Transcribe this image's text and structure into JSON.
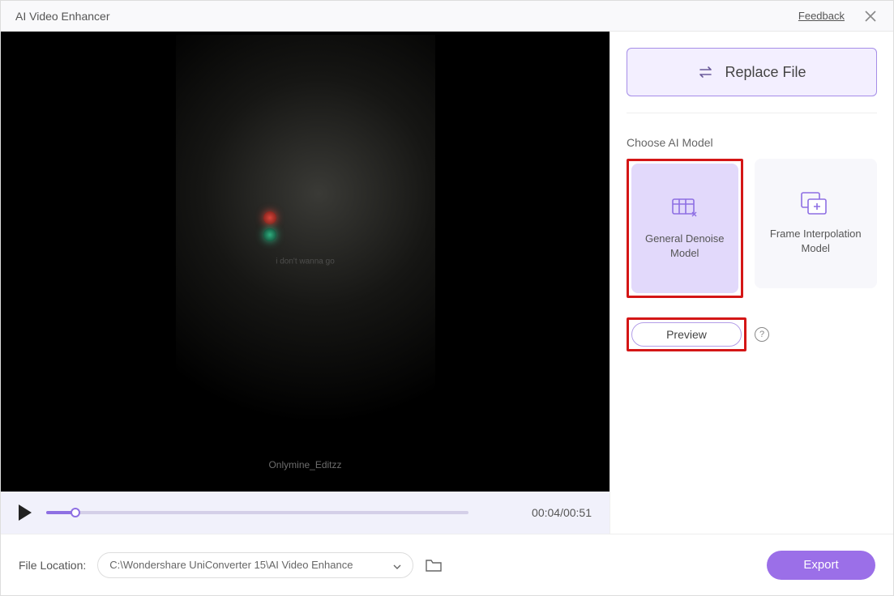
{
  "titlebar": {
    "title": "AI Video Enhancer",
    "feedback": "Feedback"
  },
  "player": {
    "time": "00:04/00:51",
    "caption": "i don't wanna go",
    "watermark": "Onlymine_Editzz"
  },
  "sidebar": {
    "replace_label": "Replace File",
    "section_label": "Choose AI Model",
    "models": [
      {
        "label": "General Denoise Model"
      },
      {
        "label": "Frame Interpolation Model"
      }
    ],
    "preview_label": "Preview",
    "help_tooltip": "?"
  },
  "footer": {
    "location_label": "File Location:",
    "path": "C:\\Wondershare UniConverter 15\\AI Video Enhance",
    "export_label": "Export"
  }
}
